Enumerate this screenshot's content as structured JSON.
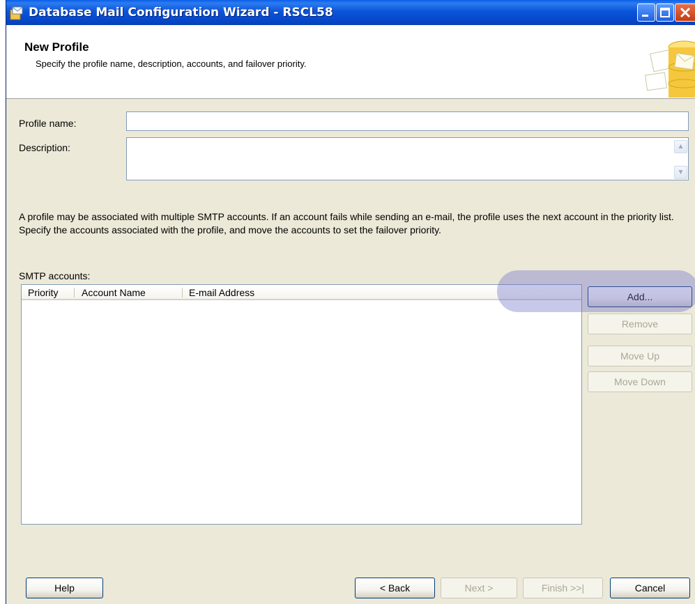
{
  "window": {
    "title": "Database Mail Configuration Wizard - RSCL58"
  },
  "header": {
    "title": "New Profile",
    "subtitle": "Specify the profile name, description, accounts, and failover priority."
  },
  "form": {
    "profile_name_label": "Profile name:",
    "profile_name_value": "",
    "description_label": "Description:",
    "description_value": ""
  },
  "info_text": "A profile may be associated with multiple SMTP accounts. If an account fails while sending an e-mail, the profile uses the next account in the priority list. Specify the accounts associated with the profile, and move the accounts to set the failover priority.",
  "smtp": {
    "label": "SMTP accounts:",
    "columns": [
      "Priority",
      "Account Name",
      "E-mail Address"
    ],
    "rows": []
  },
  "side_buttons": {
    "add": "Add...",
    "remove": "Remove",
    "move_up": "Move Up",
    "move_down": "Move Down"
  },
  "footer_buttons": {
    "help": "Help",
    "back": "< Back",
    "next": "Next >",
    "finish": "Finish >>|",
    "cancel": "Cancel"
  },
  "colors": {
    "titlebar": "#0b55d9",
    "dialog_bg": "#ece9d8",
    "highlight": "#6e6ec8"
  }
}
